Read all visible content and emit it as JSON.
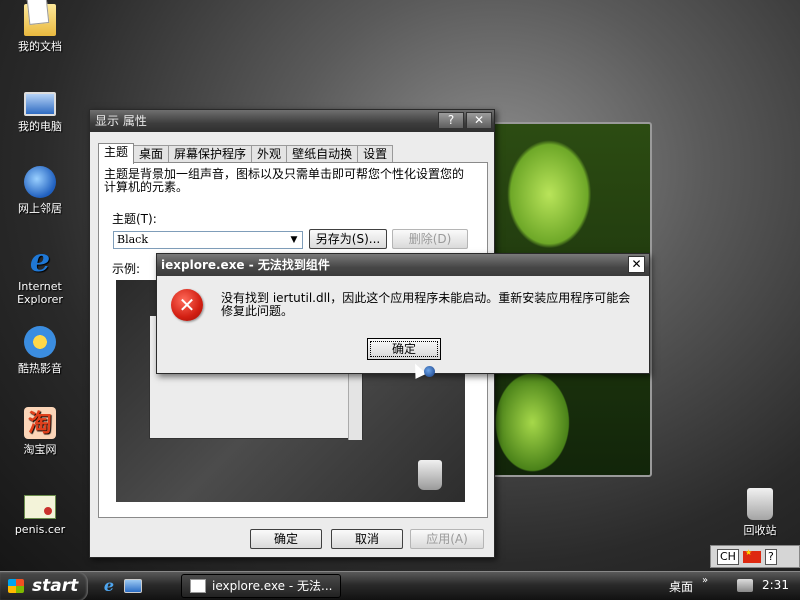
{
  "desktop": {
    "icons": [
      {
        "label": "我的文档",
        "icon": "my-documents-icon"
      },
      {
        "label": "我的电脑",
        "icon": "my-computer-icon"
      },
      {
        "label": "网上邻居",
        "icon": "network-places-icon"
      },
      {
        "label": "Internet Explorer",
        "icon": "internet-explorer-icon"
      },
      {
        "label": "酷热影音",
        "icon": "kuer-player-icon"
      },
      {
        "label": "淘宝网",
        "icon": "taobao-icon"
      },
      {
        "label": "penis.cer",
        "icon": "certificate-icon"
      }
    ],
    "recycle_bin": {
      "label": "回收站",
      "icon": "recycle-bin-icon"
    }
  },
  "display_properties": {
    "title": "显示 属性",
    "title_buttons": {
      "help": "?",
      "close": "✕"
    },
    "tabs": [
      {
        "label": "主题",
        "active": true
      },
      {
        "label": "桌面"
      },
      {
        "label": "屏幕保护程序"
      },
      {
        "label": "外观"
      },
      {
        "label": "壁纸自动换"
      },
      {
        "label": "设置"
      }
    ],
    "description": "主题是背景加一组声音，图标以及只需单击即可帮您个性化设置您的计算机的元素。",
    "theme_label": "主题(T):",
    "theme_value": "Black",
    "save_as_label": "另存为(S)...",
    "delete_label": "删除(D)",
    "sample_label": "示例:",
    "ok_label": "确定",
    "cancel_label": "取消",
    "apply_label": "应用(A)"
  },
  "error_dialog": {
    "title": "iexplore.exe - 无法找到组件",
    "close": "✕",
    "message": "没有找到 iertutil.dll，因此这个应用程序未能启动。重新安装应用程序可能会修复此问题。",
    "ok_label": "确定"
  },
  "language_bar": {
    "lang": "CH",
    "help": "?"
  },
  "taskbar": {
    "start_label": "start",
    "task_label": "iexplore.exe - 无法...",
    "desktop_label": "桌面",
    "chevron": "»",
    "clock": "2:31"
  },
  "colors": {
    "error_red": "#d21f12",
    "title_bar": "#3d3d3d",
    "taskbar": "#1c1c1c"
  }
}
